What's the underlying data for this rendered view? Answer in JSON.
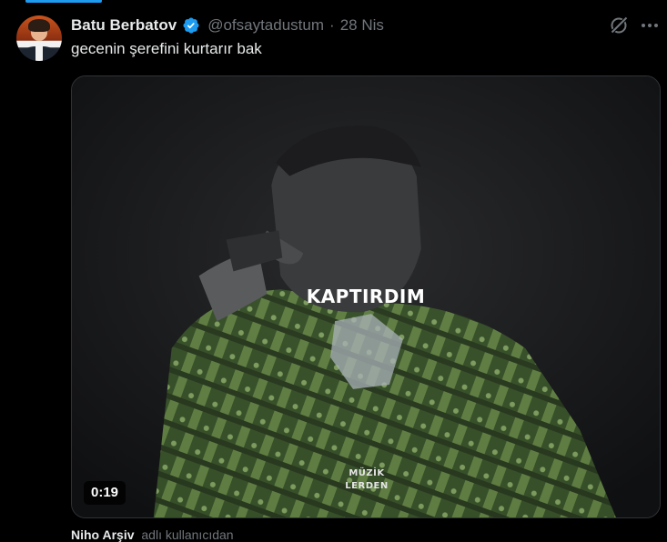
{
  "tweet": {
    "author": {
      "display_name": "Batu Berbatov",
      "handle": "@ofsaytadustum",
      "verified": true,
      "avatar_icon": "user-avatar"
    },
    "separator": "·",
    "date": "28 Nis",
    "text": "gecenin şerefini kurtarır bak",
    "actions": {
      "grok_icon": "grok-icon",
      "more_icon": "more-horizontal-icon"
    },
    "media": {
      "type": "video",
      "duration": "0:19",
      "caption_overlay": "KAPTIRDIM",
      "watermark": [
        "MÜZİK",
        "LERDEN"
      ]
    },
    "attribution": {
      "user": "Niho Arşiv",
      "suffix": "adlı kullanıcıdan"
    }
  },
  "colors": {
    "background": "#000000",
    "text_primary": "#e7e9ea",
    "text_secondary": "#71767b",
    "verified_blue": "#1d9bf0",
    "border": "#2f3336"
  }
}
